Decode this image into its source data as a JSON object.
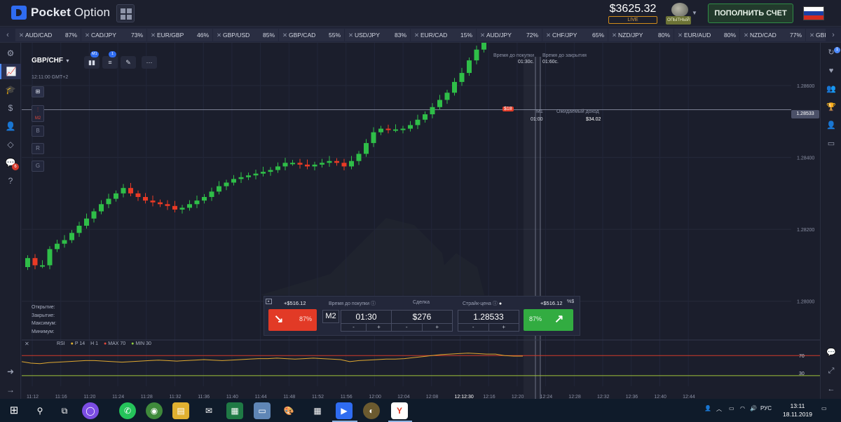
{
  "header": {
    "brand_bold": "Pocket",
    "brand_light": " Option",
    "balance": "$3625.32",
    "balance_mode": "LIVE",
    "level": "ОПЫТНЫЙ",
    "deposit_label": "ПОПОЛНИТЬ СЧЕТ",
    "language_flag": "RU"
  },
  "assets": [
    {
      "name": "AUD/CAD",
      "pct": "87%"
    },
    {
      "name": "CAD/JPY",
      "pct": "73%"
    },
    {
      "name": "EUR/GBP",
      "pct": "46%"
    },
    {
      "name": "GBP/USD",
      "pct": "85%"
    },
    {
      "name": "GBP/CAD",
      "pct": "55%"
    },
    {
      "name": "USD/JPY",
      "pct": "83%"
    },
    {
      "name": "EUR/CAD",
      "pct": "15%"
    },
    {
      "name": "AUD/JPY",
      "pct": "72%"
    },
    {
      "name": "CHF/JPY",
      "pct": "65%"
    },
    {
      "name": "NZD/JPY",
      "pct": "80%"
    },
    {
      "name": "EUR/AUD",
      "pct": "80%"
    },
    {
      "name": "NZD/CAD",
      "pct": "77%"
    },
    {
      "name": "GBI",
      "pct": ""
    }
  ],
  "chart_toolbar": {
    "pair": "GBP/CHF",
    "timeframe_badge": "M1",
    "indicators_badge": "1",
    "server_time": "12:11:00 GMT+2"
  },
  "chart_side_buttons": [
    "M2",
    "B",
    "R",
    "G"
  ],
  "ohlc_labels": [
    "Открытие:",
    "Закрытие:",
    "Максимум:",
    "Минимум:"
  ],
  "trade_info": {
    "time_to_buy_label": "Время до покупки",
    "time_to_buy": "01:30с.",
    "time_to_close_label": "Время до закрытия",
    "time_to_close": "01:60с.",
    "m1_label": "M1",
    "m1_time": "01:00",
    "expected_income_label": "Ожидаемый доход",
    "expected_income": "$34.02",
    "trade_marker": "$18",
    "current_price": "1.28533"
  },
  "trade_panel": {
    "sell_profit": "+$516.12",
    "sell_pct": "87%",
    "buy_profit": "+$516.12",
    "buy_pct": "87%",
    "purchase_time_label": "Время до покупки",
    "purchase_mode": "M2",
    "purchase_time": "01:30",
    "amount_label": "Сделка",
    "amount": "$276",
    "strike_label": "Страйк-цена",
    "strike_price": "1.28533",
    "currency_toggle": "%$"
  },
  "rsi": {
    "label": "RSI",
    "p": "P 14",
    "h": "H 1",
    "max": "MAX 70",
    "min": "MIN 30",
    "level_high": "70",
    "level_low": "30"
  },
  "chart_data": {
    "type": "candlestick",
    "x_ticks": [
      "11:12",
      "11:16",
      "11:20",
      "11:24",
      "11:28",
      "11:32",
      "11:36",
      "11:40",
      "11:44",
      "11:48",
      "11:52",
      "11:56",
      "12:00",
      "12:04",
      "12:08",
      "12:12:30",
      "12:16",
      "12:20",
      "12:24",
      "12:28",
      "12:32",
      "12:36",
      "12:40",
      "12:44"
    ],
    "y_ticks": [
      "1.28600",
      "1.28400",
      "1.28200",
      "1.28000"
    ],
    "ylim": [
      1.279,
      1.2868
    ],
    "current_price": 1.28533,
    "candles_close": [
      1.2812,
      1.281,
      1.281,
      1.28145,
      1.2816,
      1.2817,
      1.2819,
      1.2821,
      1.2823,
      1.2825,
      1.2827,
      1.28285,
      1.283,
      1.28315,
      1.283,
      1.2829,
      1.2828,
      1.28275,
      1.2827,
      1.28265,
      1.28255,
      1.2826,
      1.2827,
      1.2828,
      1.2829,
      1.28305,
      1.2832,
      1.2833,
      1.2834,
      1.28345,
      1.2835,
      1.28355,
      1.2836,
      1.28365,
      1.28375,
      1.28385,
      1.28385,
      1.2838,
      1.28375,
      1.2838,
      1.28385,
      1.2839,
      1.28385,
      1.28375,
      1.2839,
      1.2841,
      1.2844,
      1.2847,
      1.2848,
      1.28478,
      1.28478,
      1.2848,
      1.2849,
      1.28505,
      1.2852,
      1.2854,
      1.2856,
      1.2858,
      1.2861,
      1.28635,
      1.2867,
      1.287,
      1.2873,
      1.2876,
      1.2882,
      1.2881,
      1.2881,
      1.288
    ],
    "rsi_values": [
      58,
      55,
      54,
      56,
      57,
      58,
      59,
      60,
      60,
      59,
      58,
      57,
      58,
      59,
      60,
      61,
      60,
      59,
      60,
      61,
      62,
      61,
      60,
      61,
      62,
      63,
      64,
      64,
      65,
      64,
      63,
      64,
      65,
      64,
      63,
      62,
      58,
      60,
      61,
      62,
      63,
      63,
      64,
      66,
      68,
      70,
      72,
      73,
      74,
      75,
      74,
      73,
      73,
      70,
      69,
      69
    ]
  },
  "taskbar": {
    "lang": "РУС",
    "time": "13:11",
    "date": "18.11.2019"
  }
}
